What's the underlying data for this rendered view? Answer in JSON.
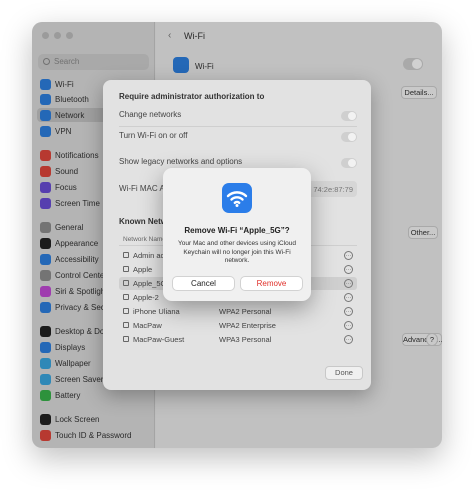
{
  "window": {
    "title": "Wi-Fi"
  },
  "sidebar": {
    "search_placeholder": "Search",
    "items": [
      {
        "label": "Wi-Fi",
        "color": "#2d7fe0"
      },
      {
        "label": "Bluetooth",
        "color": "#2d7fe0"
      },
      {
        "label": "Network",
        "color": "#2d7fe0"
      },
      {
        "label": "VPN",
        "color": "#2d7fe0"
      },
      {
        "label": "Notifications",
        "color": "#e0463b"
      },
      {
        "label": "Sound",
        "color": "#e0463b"
      },
      {
        "label": "Focus",
        "color": "#6a4ed6"
      },
      {
        "label": "Screen Time",
        "color": "#6a4ed6"
      },
      {
        "label": "General",
        "color": "#8e8e8e"
      },
      {
        "label": "Appearance",
        "color": "#222222"
      },
      {
        "label": "Accessibility",
        "color": "#2d7fe0"
      },
      {
        "label": "Control Center",
        "color": "#8e8e8e"
      },
      {
        "label": "Siri & Spotlight",
        "color": "#c24ad6"
      },
      {
        "label": "Privacy & Security",
        "color": "#2d7fe0"
      },
      {
        "label": "Desktop & Dock",
        "color": "#222222"
      },
      {
        "label": "Displays",
        "color": "#2d7fe0"
      },
      {
        "label": "Wallpaper",
        "color": "#3aa7e0"
      },
      {
        "label": "Screen Saver",
        "color": "#3aa7e0"
      },
      {
        "label": "Battery",
        "color": "#37b34a"
      },
      {
        "label": "Lock Screen",
        "color": "#222222"
      },
      {
        "label": "Touch ID & Password",
        "color": "#e0463b"
      }
    ]
  },
  "content": {
    "wifi_label": "Wi-Fi",
    "details_button": "Details...",
    "other_button": "Other...",
    "advanced_button": "Advanced...",
    "help_button": "?"
  },
  "sheet": {
    "title": "Require administrator authorization to",
    "options": [
      "Change networks",
      "Turn Wi-Fi on or off"
    ],
    "legacy_label": "Show legacy networks and options",
    "mac_label": "Wi-Fi MAC Address",
    "mac_value": "74:2e:87:79",
    "known_title": "Known Networks",
    "column_header": "Network Name",
    "networks": [
      {
        "name": "Admin access",
        "security": ""
      },
      {
        "name": "Apple",
        "security": ""
      },
      {
        "name": "Apple_5G",
        "security": ""
      },
      {
        "name": "Apple-2",
        "security": ""
      },
      {
        "name": "iPhone Uliana",
        "security": "WPA2 Personal"
      },
      {
        "name": "MacPaw",
        "security": "WPA2 Enterprise"
      },
      {
        "name": "MacPaw-Guest",
        "security": "WPA3 Personal"
      }
    ],
    "done_button": "Done"
  },
  "alert": {
    "title": "Remove Wi-Fi “Apple_5G”?",
    "message": "Your Mac and other devices using iCloud Keychain will no longer join this Wi-Fi network.",
    "cancel_button": "Cancel",
    "remove_button": "Remove",
    "remove_color": "#e0302a"
  }
}
